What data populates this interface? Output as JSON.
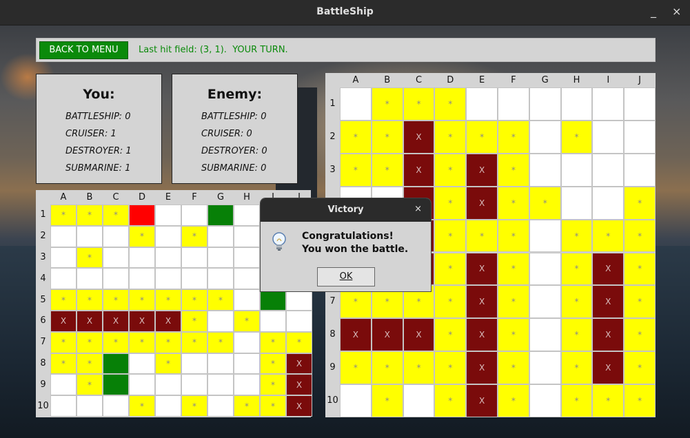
{
  "window": {
    "title": "BattleShip",
    "minimize": "_",
    "close": "×"
  },
  "topbar": {
    "back_label": "BACK TO MENU",
    "status": "Last hit field: (3, 1).  YOUR TURN."
  },
  "you_panel": {
    "title": "You:",
    "rows": [
      "BATTLESHIP: 0",
      "CRUISER: 1",
      "DESTROYER: 1",
      "SUBMARINE: 1"
    ]
  },
  "enemy_panel": {
    "title": "Enemy:",
    "rows": [
      "BATTLESHIP: 0",
      "CRUISER: 0",
      "DESTROYER: 0",
      "SUBMARINE: 0"
    ]
  },
  "legend": {
    "miss": "*",
    "hit": "X"
  },
  "columns": [
    "A",
    "B",
    "C",
    "D",
    "E",
    "F",
    "G",
    "H",
    "I",
    "J"
  ],
  "rows": [
    "1",
    "2",
    "3",
    "4",
    "5",
    "6",
    "7",
    "8",
    "9",
    "10"
  ],
  "player_board": [
    "MMMREEG___",
    "___M_M____",
    "_M________",
    "__________",
    "MMMMMMM_G_",
    "XXXXXM_M__",
    "MMMMMMM_MM",
    "MMG_M___MX",
    "_MG_____MX",
    "___M_M_MMX"
  ],
  "enemy_board": [
    "_MMM______",
    "MMXMMM_M__",
    "MMXMXM____",
    "__XMXMM__M",
    "__XMMM_MMM",
    "__XMXM_MXM",
    "MMMMXM_MXM",
    "XXXMXM_MXM",
    "MMMMXM_MXM",
    "_M_MXM_MMM"
  ],
  "dialog": {
    "title": "Victory",
    "close": "×",
    "line1": "Congratulations!",
    "line2": "You won the battle.",
    "ok": "OK",
    "icon": "lightbulb-icon"
  },
  "colors": {
    "miss": "#ffff00",
    "hit": "#7a0b0b",
    "ship": "#078007",
    "last_hit": "#ff0000",
    "empty": "#ffffff",
    "accent": "#0a8a0a"
  }
}
